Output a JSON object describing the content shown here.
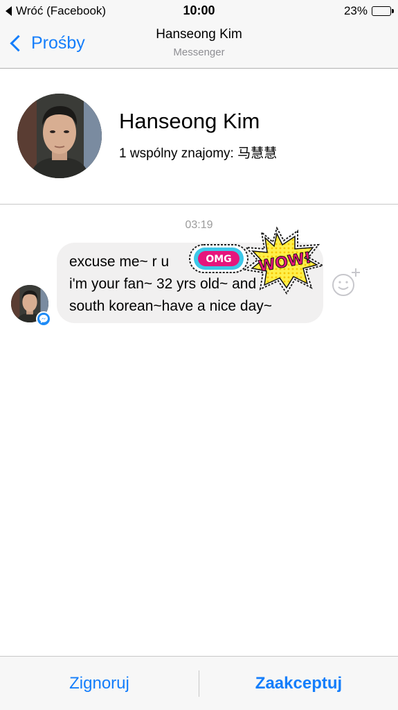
{
  "status_bar": {
    "back_app": "Wróć (Facebook)",
    "time": "10:00",
    "battery": "23%",
    "battery_level": 0.23
  },
  "nav": {
    "back_label": "Prośby",
    "title": "Hanseong Kim",
    "subtitle": "Messenger"
  },
  "profile": {
    "name": "Hanseong Kim",
    "mutual_friends": "1 wspólny znajomy: 马慧慧"
  },
  "conversation": {
    "timestamp": "03:19",
    "message": {
      "line1": "excuse me~ r u",
      "line2": "i'm your fan~ 32 yrs old~ and",
      "line3": "south korean~have a nice day~"
    },
    "stickers": {
      "omg": "OMG",
      "wow": "WOW!"
    }
  },
  "actions": {
    "ignore": "Zignoruj",
    "accept": "Zaakceptuj"
  },
  "colors": {
    "accent": "#147efb",
    "bubble": "#f1f0f0",
    "messenger_badge": "#1e8bf6"
  }
}
